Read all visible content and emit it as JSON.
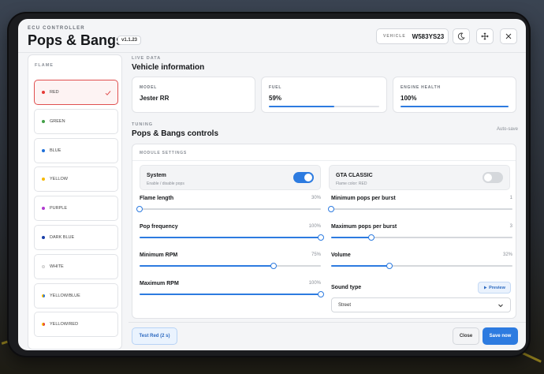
{
  "header": {
    "kicker": "ECU CONTROLLER",
    "title": "Pops & Bangs",
    "version": "v1.1.23",
    "vehicle_label": "VEHICLE",
    "vehicle_plate": "W583YS23"
  },
  "icons": {
    "theme": "moon-icon",
    "move": "move-icon",
    "close": "close-icon",
    "check": "check-icon",
    "play": "play-icon",
    "chevron": "chevron-down-icon"
  },
  "flame": {
    "title": "FLAME",
    "selected": "RED",
    "items": [
      {
        "label": "RED",
        "color": "#e53935"
      },
      {
        "label": "GREEN",
        "color": "#43a047"
      },
      {
        "label": "BLUE",
        "color": "#1e6fd9"
      },
      {
        "label": "YELLOW",
        "color": "#f5b800"
      },
      {
        "label": "PURPLE",
        "color": "#b03ad0"
      },
      {
        "label": "DARK BLUE",
        "color": "#1a3fa8"
      },
      {
        "label": "WHITE",
        "color": "#eeeeee"
      },
      {
        "label": "YELLOW/BLUE",
        "color": "#f5b800"
      },
      {
        "label": "YELLOW/RED",
        "color": "#f57c00"
      }
    ]
  },
  "live": {
    "kicker": "LIVE DATA",
    "title": "Vehicle information",
    "model_label": "MODEL",
    "model_value": "Jester RR",
    "fuel_label": "FUEL",
    "fuel_value": "59%",
    "fuel_fraction": 0.59,
    "health_label": "ENGINE HEALTH",
    "health_value": "100%",
    "health_fraction": 1.0
  },
  "tuning": {
    "kicker": "TUNING",
    "title": "Pops & Bangs controls",
    "autosave": "Auto-save",
    "module_title": "MODULE SETTINGS",
    "system": {
      "title": "System",
      "subtitle": "Enable / disable pops",
      "on": true
    },
    "gta": {
      "title": "GTA CLASSIC",
      "subtitle": "Flame color: RED",
      "on": false
    },
    "sliders_left": [
      {
        "name": "Flame length",
        "value_text": "30%",
        "fraction": 0.0
      },
      {
        "name": "Pop frequency",
        "value_text": "100%",
        "fraction": 1.0
      },
      {
        "name": "Minimum RPM",
        "value_text": "75%",
        "fraction": 0.74
      },
      {
        "name": "Maximum RPM",
        "value_text": "100%",
        "fraction": 1.0
      }
    ],
    "sliders_right": [
      {
        "name": "Minimum pops per burst",
        "value_text": "1",
        "fraction": 0.0
      },
      {
        "name": "Maximum pops per burst",
        "value_text": "3",
        "fraction": 0.22
      },
      {
        "name": "Volume",
        "value_text": "32%",
        "fraction": 0.32
      }
    ],
    "sound_label": "Sound type",
    "preview_label": "Preview",
    "sound_value": "Street"
  },
  "footer": {
    "test_label": "Test Red (2 s)",
    "close_label": "Close",
    "save_label": "Save now"
  }
}
